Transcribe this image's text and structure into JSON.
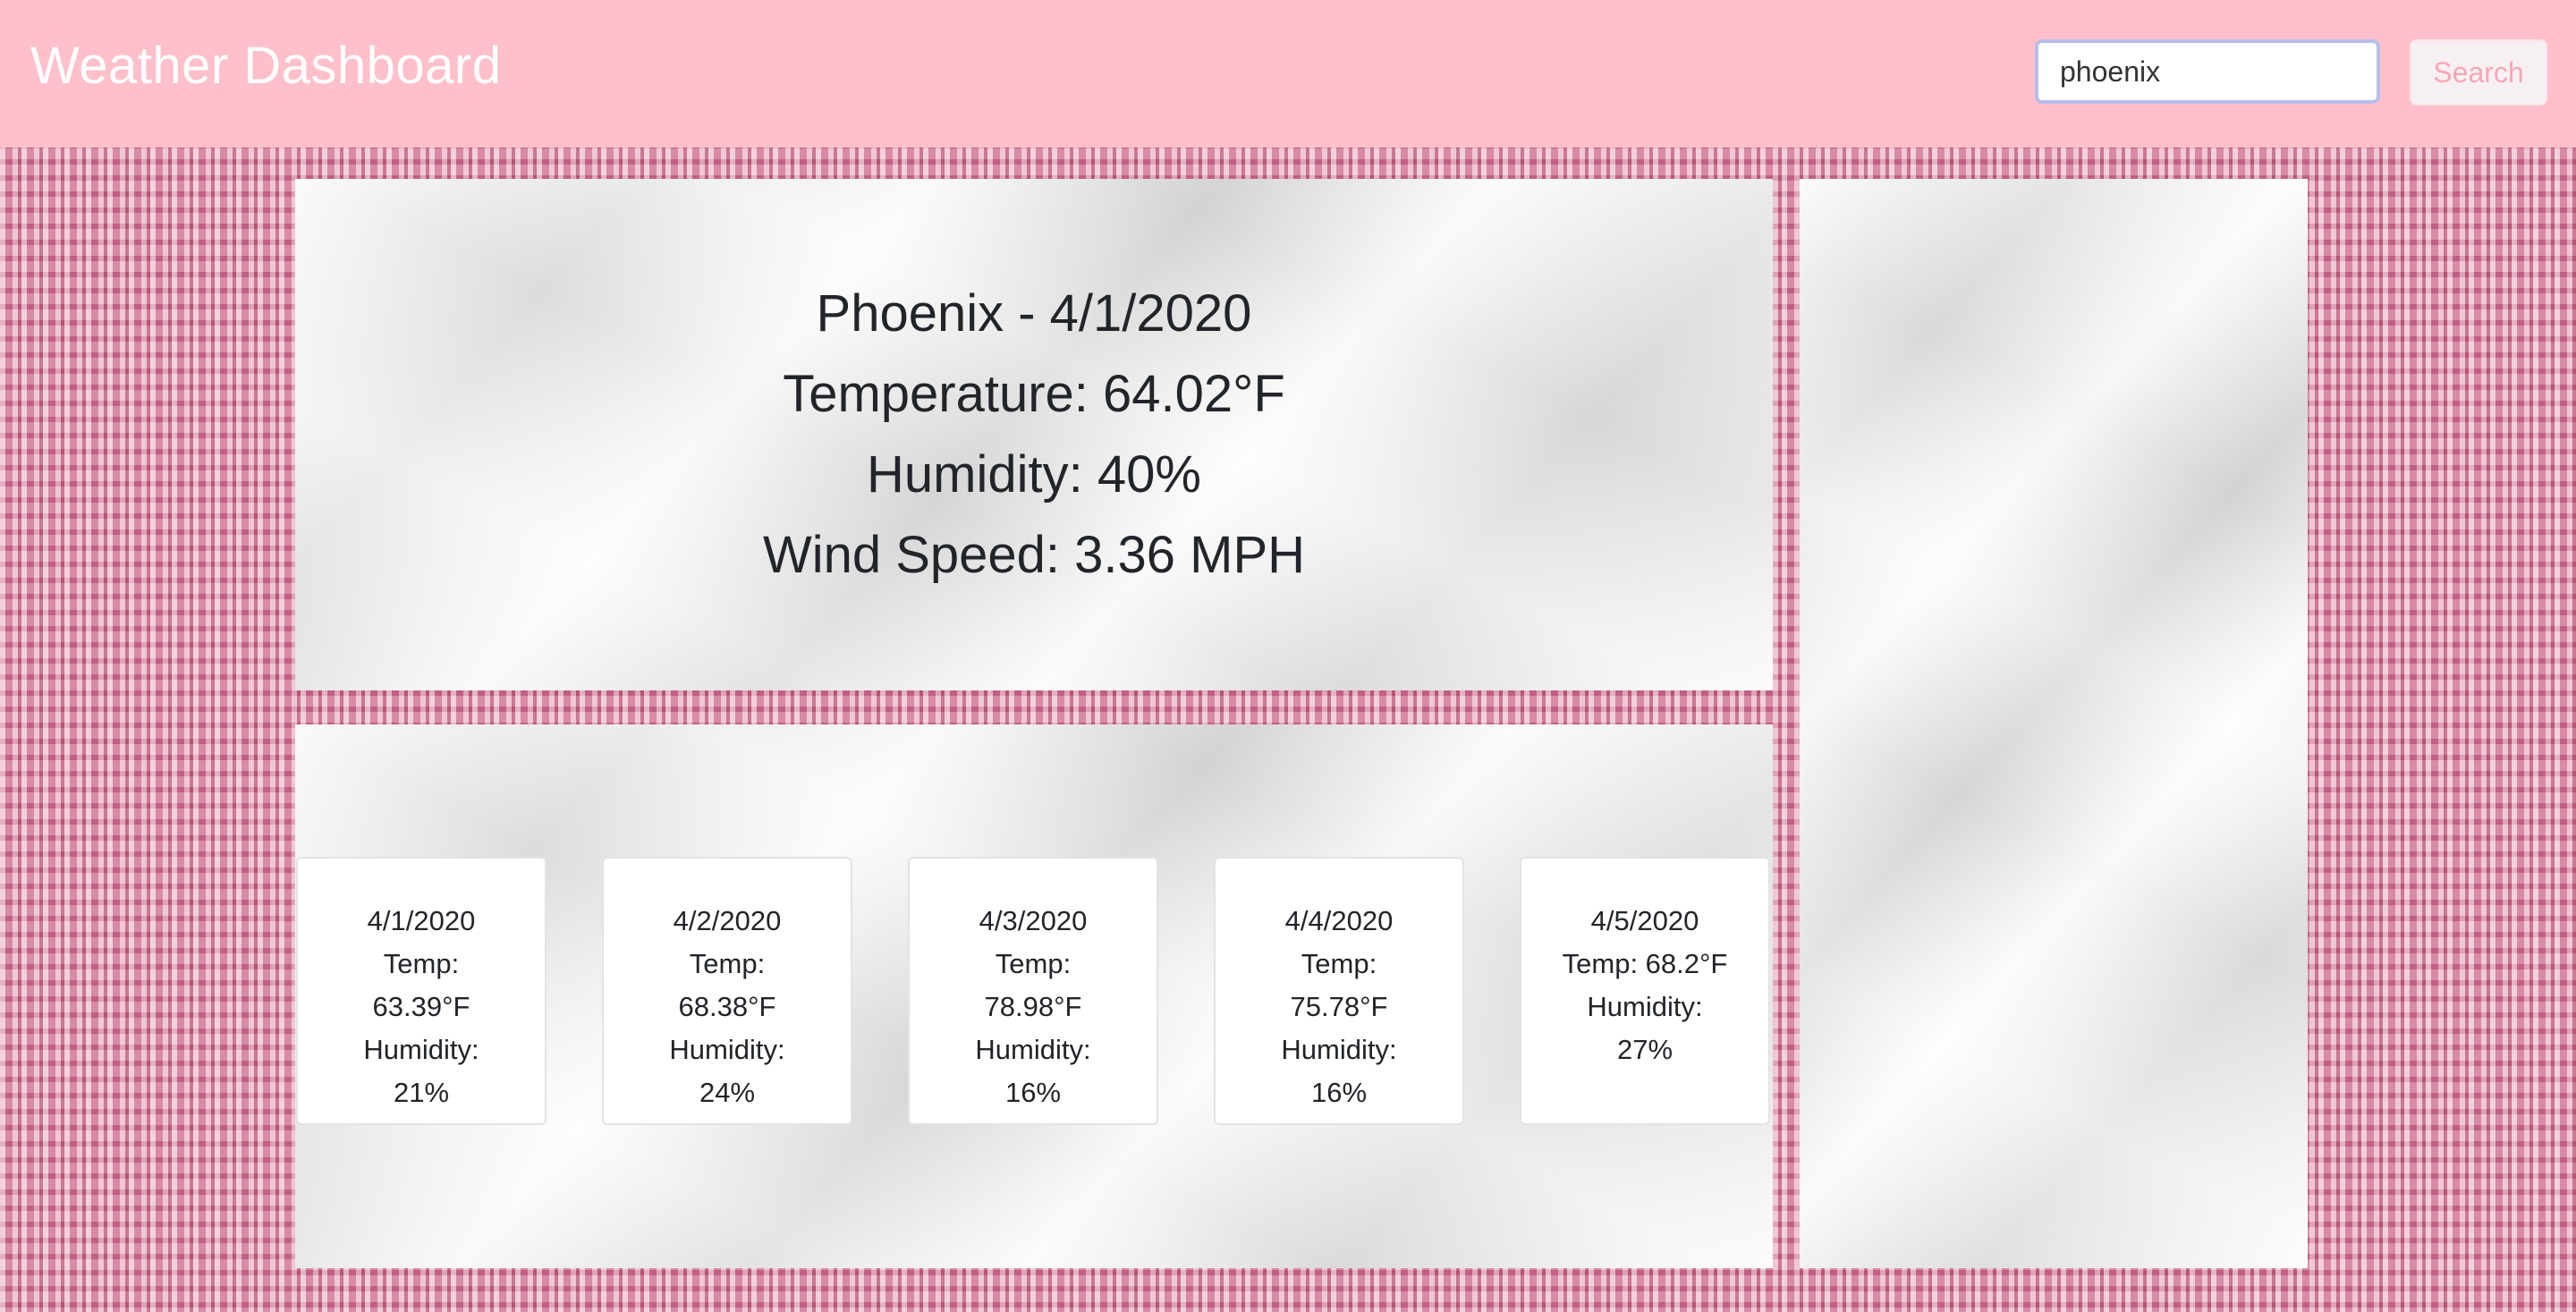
{
  "header": {
    "title": "Weather Dashboard",
    "search_value": "phoenix",
    "search_button": "Search"
  },
  "current": {
    "city_date": "Phoenix - 4/1/2020",
    "temperature": "Temperature: 64.02°F",
    "humidity": "Humidity: 40%",
    "wind": "Wind Speed: 3.36 MPH"
  },
  "forecast": [
    {
      "lines": [
        "4/1/2020",
        "Temp:",
        "63.39°F",
        "Humidity:",
        "21%"
      ]
    },
    {
      "lines": [
        "4/2/2020",
        "Temp:",
        "68.38°F",
        "Humidity:",
        "24%"
      ]
    },
    {
      "lines": [
        "4/3/2020",
        "Temp:",
        "78.98°F",
        "Humidity:",
        "16%"
      ]
    },
    {
      "lines": [
        "4/4/2020",
        "Temp:",
        "75.78°F",
        "Humidity:",
        "16%"
      ]
    },
    {
      "lines": [
        "4/5/2020",
        "Temp: 68.2°F",
        "Humidity:",
        "27%"
      ]
    }
  ],
  "colors": {
    "navbar": "#ffc0cb",
    "search_text": "#f5a7b8",
    "background_fabric": "#d98aa6"
  }
}
